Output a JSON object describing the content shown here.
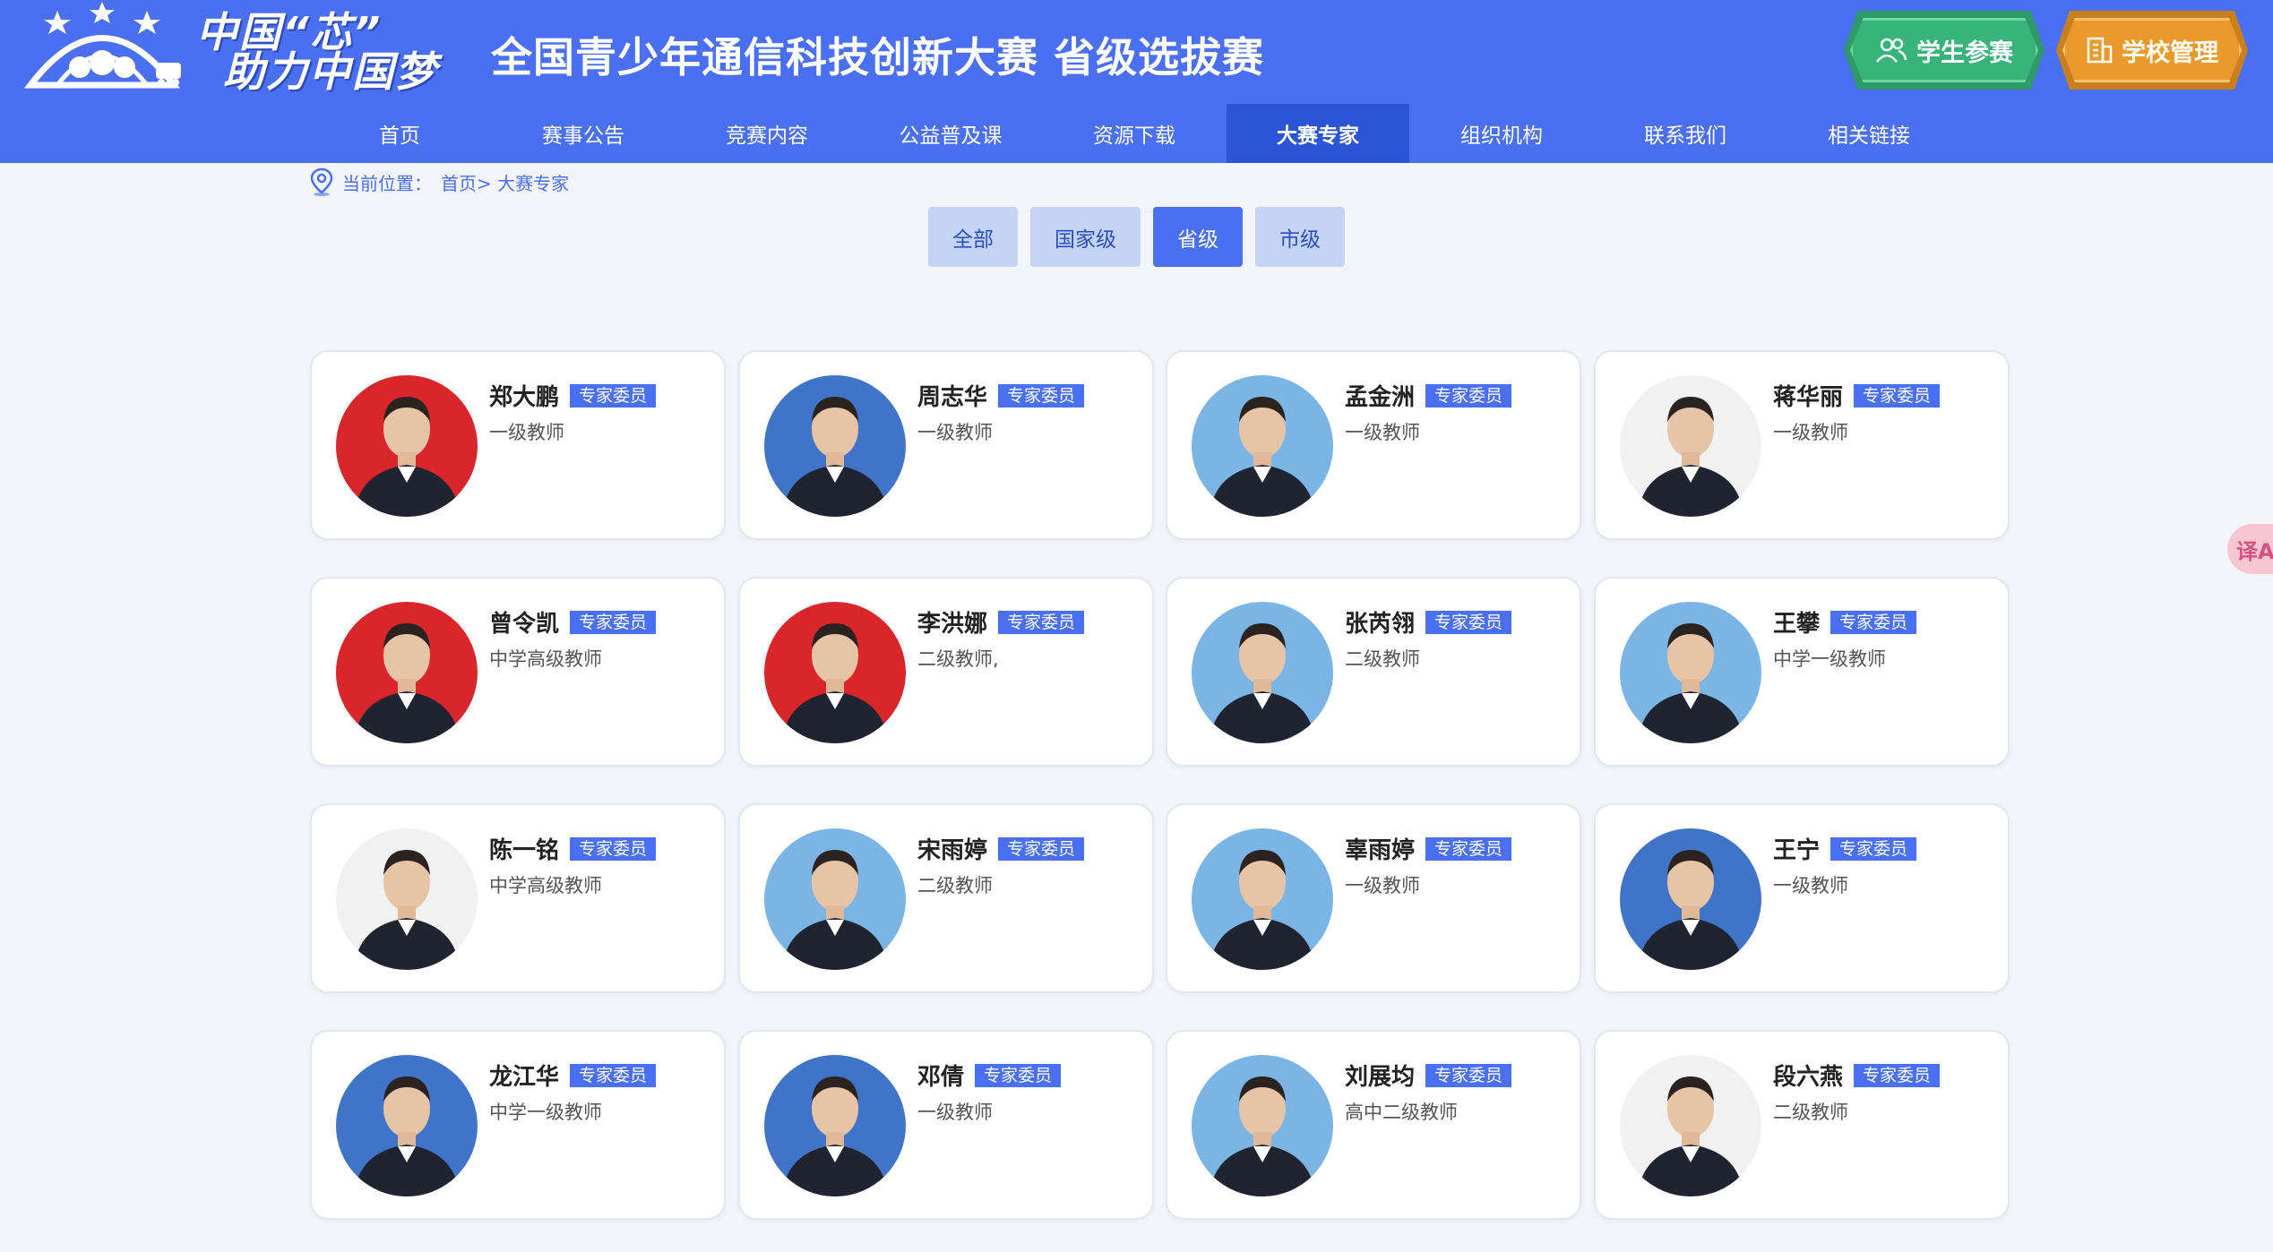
{
  "logo": {
    "line1": "中国“芯”",
    "line2": "助力中国梦"
  },
  "site_title": "全国青少年通信科技创新大赛 省级选拔赛",
  "header_buttons": {
    "student": "学生参赛",
    "school": "学校管理"
  },
  "colors": {
    "primary": "#4a6ff0",
    "nav_active": "#2b55d6",
    "student_btn": "#38b37a",
    "school_btn": "#e99a2b",
    "badge": "#4a6ff0"
  },
  "nav": {
    "items": [
      "首页",
      "赛事公告",
      "竞赛内容",
      "公益普及课",
      "资源下载",
      "大赛专家",
      "组织机构",
      "联系我们",
      "相关链接"
    ],
    "active": "大赛专家"
  },
  "breadcrumb": {
    "prefix": "当前位置：",
    "path": "首页> 大赛专家"
  },
  "filters": {
    "items": [
      "全部",
      "国家级",
      "省级",
      "市级"
    ],
    "active": "省级"
  },
  "experts": [
    {
      "name": "郑大鹏",
      "badge": "专家委员",
      "title": "一级教师",
      "bg": "red"
    },
    {
      "name": "周志华",
      "badge": "专家委员",
      "title": "一级教师",
      "bg": "blue"
    },
    {
      "name": "孟金洲",
      "badge": "专家委员",
      "title": "一级教师",
      "bg": "light-blue"
    },
    {
      "name": "蒋华丽",
      "badge": "专家委员",
      "title": "一级教师",
      "bg": "white"
    },
    {
      "name": "曾令凯",
      "badge": "专家委员",
      "title": "中学高级教师",
      "bg": "red"
    },
    {
      "name": "李洪娜",
      "badge": "专家委员",
      "title": "二级教师,",
      "bg": "red"
    },
    {
      "name": "张芮翎",
      "badge": "专家委员",
      "title": "二级教师",
      "bg": "light-blue"
    },
    {
      "name": "王攀",
      "badge": "专家委员",
      "title": "中学一级教师",
      "bg": "light-blue"
    },
    {
      "name": "陈一铭",
      "badge": "专家委员",
      "title": "中学高级教师",
      "bg": "white"
    },
    {
      "name": "宋雨婷",
      "badge": "专家委员",
      "title": "二级教师",
      "bg": "light-blue"
    },
    {
      "name": "辜雨婷",
      "badge": "专家委员",
      "title": "一级教师",
      "bg": "light-blue"
    },
    {
      "name": "王宁",
      "badge": "专家委员",
      "title": "一级教师",
      "bg": "blue"
    },
    {
      "name": "龙江华",
      "badge": "专家委员",
      "title": "中学一级教师",
      "bg": "blue"
    },
    {
      "name": "邓倩",
      "badge": "专家委员",
      "title": "一级教师",
      "bg": "blue"
    },
    {
      "name": "刘展均",
      "badge": "专家委员",
      "title": "高中二级教师",
      "bg": "light-blue"
    },
    {
      "name": "段六燕",
      "badge": "专家委员",
      "title": "二级教师",
      "bg": "white"
    }
  ],
  "side_button": {
    "icon": "translate-icon",
    "label": "译A"
  }
}
